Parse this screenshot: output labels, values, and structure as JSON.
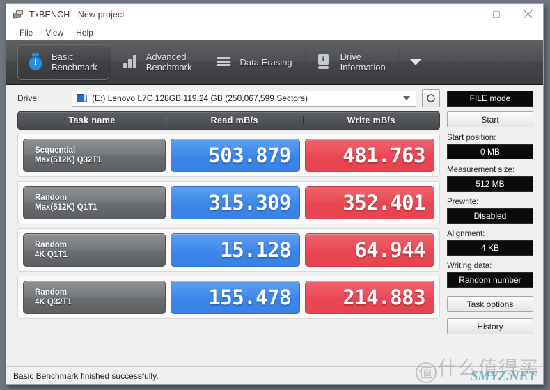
{
  "window": {
    "title": "TxBENCH - New project",
    "icon": "app-icon",
    "minimize": "–",
    "maximize": "□",
    "close": "✕"
  },
  "menubar": {
    "items": [
      {
        "label": "File"
      },
      {
        "label": "View"
      },
      {
        "label": "Help"
      }
    ]
  },
  "tabs": [
    {
      "id": "basic-benchmark",
      "line1": "Basic",
      "line2": "Benchmark",
      "icon": "stopwatch-icon",
      "active": true
    },
    {
      "id": "advanced-benchmark",
      "line1": "Advanced",
      "line2": "Benchmark",
      "icon": "bar-chart-icon",
      "active": false
    },
    {
      "id": "data-erasing",
      "line1": "Data Erasing",
      "line2": "",
      "icon": "erase-icon",
      "active": false
    },
    {
      "id": "drive-information",
      "line1": "Drive",
      "line2": "Information",
      "icon": "drive-info-icon",
      "active": false
    }
  ],
  "tab_overflow_icon": "chevron-down-icon",
  "drivebar": {
    "label": "Drive:",
    "selected_drive": "(E:) Lenovo L7C 128GB  119.24 GB (250,067,599 Sectors)",
    "drive_icon": "disk-icon",
    "caret_icon": "chevron-down-icon",
    "refresh_icon": "refresh-icon",
    "file_mode_label": "FILE mode"
  },
  "results": {
    "columns": [
      "Task name",
      "Read mB/s",
      "Write mB/s"
    ],
    "rows": [
      {
        "task_line1": "Sequential",
        "task_line2": "Max(512K) Q32T1",
        "read": "503.879",
        "write": "481.763"
      },
      {
        "task_line1": "Random",
        "task_line2": "Max(512K) Q1T1",
        "read": "315.309",
        "write": "352.401"
      },
      {
        "task_line1": "Random",
        "task_line2": "4K Q1T1",
        "read": "15.128",
        "write": "64.944"
      },
      {
        "task_line1": "Random",
        "task_line2": "4K Q32T1",
        "read": "155.478",
        "write": "214.883"
      }
    ]
  },
  "sidebar": {
    "start_button": "Start",
    "fields": [
      {
        "label": "Start position:",
        "value": "0 MB"
      },
      {
        "label": "Measurement size:",
        "value": "512 MB"
      },
      {
        "label": "Prewrite:",
        "value": "Disabled"
      },
      {
        "label": "Alignment:",
        "value": "4 KB"
      },
      {
        "label": "Writing data:",
        "value": "Random number"
      }
    ],
    "task_options_button": "Task options",
    "history_button": "History"
  },
  "statusbar": {
    "message": "Basic Benchmark finished successfully."
  },
  "watermark": {
    "cn_mark": "值",
    "cn_text": "什么值得买",
    "en_text": "SMYZ.NET"
  },
  "colors": {
    "read_accent": "#3b86e8",
    "write_accent": "#e84751",
    "tabstrip": "#4e5053",
    "value_field_bg": "#0a0a0a",
    "task_cell": "#6b6e71"
  },
  "chart_data": {
    "type": "table",
    "title": "Basic Benchmark results",
    "categories": [
      "Sequential Max(512K) Q32T1",
      "Random Max(512K) Q1T1",
      "Random 4K Q1T1",
      "Random 4K Q32T1"
    ],
    "series": [
      {
        "name": "Read mB/s",
        "values": [
          503.879,
          315.309,
          15.128,
          155.478
        ]
      },
      {
        "name": "Write mB/s",
        "values": [
          481.763,
          352.401,
          64.944,
          214.883
        ]
      }
    ],
    "xlabel": "Task name",
    "ylabel": "mB/s"
  }
}
